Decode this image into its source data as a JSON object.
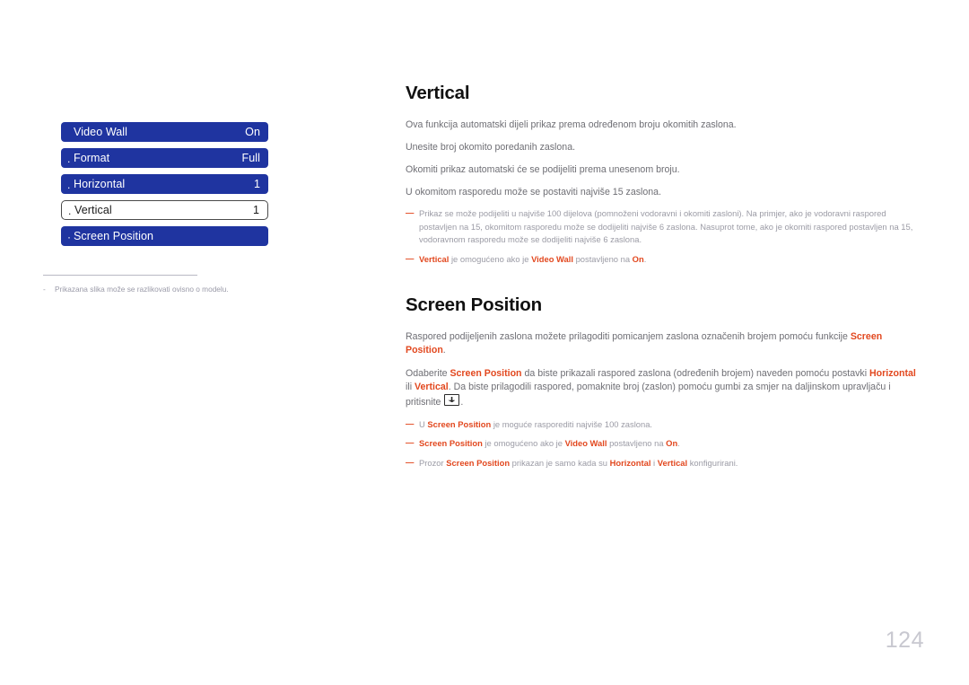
{
  "osd_menu": {
    "rows": [
      {
        "bullet": "",
        "label": "Video Wall",
        "value": "On",
        "selected": false
      },
      {
        "bullet": ".",
        "label": "Format",
        "value": "Full",
        "selected": false
      },
      {
        "bullet": ".",
        "label": "Horizontal",
        "value": "1",
        "selected": false
      },
      {
        "bullet": ".",
        "label": "Vertical",
        "value": "1",
        "selected": true
      },
      {
        "bullet": "·",
        "label": "Screen Position",
        "value": "",
        "selected": false
      }
    ],
    "footnote_dash": "-",
    "footnote": "Prikazana slika može se razlikovati ovisno o modelu."
  },
  "content": {
    "section1": {
      "title": "Vertical",
      "paragraphs": [
        "Ova funkcija automatski dijeli prikaz prema određenom broju okomitih zaslona.",
        "Unesite broj okomito poredanih zaslona.",
        "Okomiti prikaz automatski će se podijeliti prema unesenom broju.",
        "U okomitom rasporedu može se postaviti najviše 15 zaslona."
      ],
      "note1_text": "Prikaz se može podijeliti u najviše 100 dijelova (pomnoženi vodoravni i okomiti zasloni). Na primjer, ako je vodoravni raspored postavljen na 15, okomitom rasporedu može se dodijeliti najviše 6 zaslona. Nasuprot tome, ako je okomiti raspored postavljen na 15, vodoravnom rasporedu može se dodijeliti najviše 6 zaslona.",
      "note2": {
        "kw1": "Vertical",
        "t1": " je omogućeno ako je ",
        "kw2": "Video Wall",
        "t2": " postavljeno na ",
        "kw3": "On",
        "t3": "."
      }
    },
    "section2": {
      "title": "Screen Position",
      "para1": {
        "t1": "Raspored podijeljenih zaslona možete prilagoditi pomicanjem zaslona označenih brojem pomoću funkcije ",
        "kw1": "Screen Position",
        "t2": "."
      },
      "para2": {
        "t1": "Odaberite ",
        "kw1": "Screen Position",
        "t2": " da biste prikazali raspored zaslona (određenih brojem) naveden pomoću postavki ",
        "kw2": "Horizontal",
        "t3": " ili ",
        "kw3": "Vertical",
        "t4": ". Da biste prilagodili raspored, pomaknite broj (zaslon) pomoću gumbi za smjer na daljinskom upravljaču i pritisnite ",
        "t5": "."
      },
      "note1": {
        "t1": "U ",
        "kw1": "Screen Position",
        "t2": " je moguće rasporediti najviše 100 zaslona."
      },
      "note2": {
        "kw1": "Screen Position",
        "t1": " je omogućeno ako je ",
        "kw2": "Video Wall",
        "t2": " postavljeno na ",
        "kw3": "On",
        "t3": "."
      },
      "note3": {
        "t1": "Prozor ",
        "kw1": "Screen Position",
        "t2": " prikazan je samo kada su ",
        "kw2": "Horizontal",
        "t3": " i ",
        "kw3": "Vertical",
        "t4": " konfigurirani."
      }
    }
  },
  "page_number": "124",
  "colors": {
    "osd_blue": "#1f34a0",
    "accent_orange": "#e2481f",
    "body_gray": "#6e6e74",
    "note_gray": "#9b9ba5"
  }
}
